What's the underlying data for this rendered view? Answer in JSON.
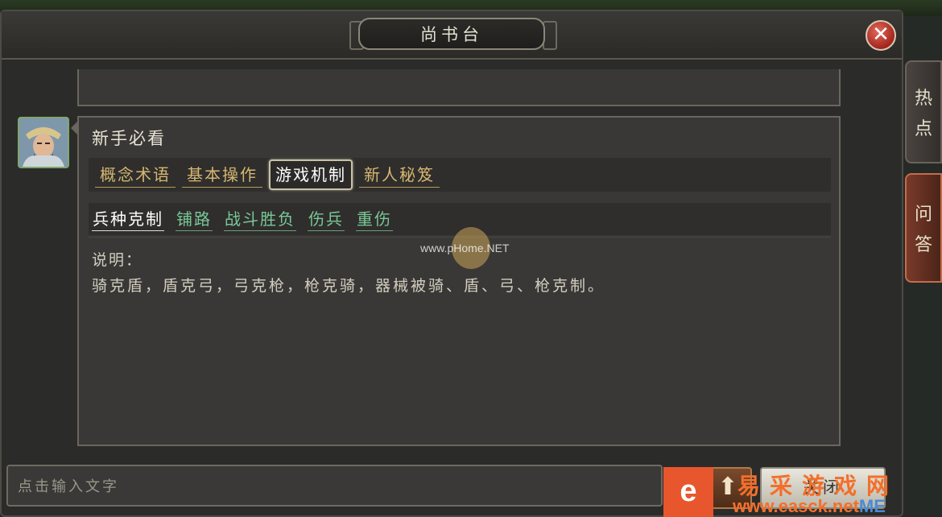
{
  "window": {
    "title": "尚书台",
    "close_symbol": "✕"
  },
  "guide": {
    "heading": "新手必看",
    "tabs": [
      {
        "label": "概念术语",
        "active": false
      },
      {
        "label": "基本操作",
        "active": false
      },
      {
        "label": "游戏机制",
        "active": true
      },
      {
        "label": "新人秘笈",
        "active": false
      }
    ],
    "subtabs": [
      {
        "label": "兵种克制",
        "active": true
      },
      {
        "label": "铺路",
        "active": false
      },
      {
        "label": "战斗胜负",
        "active": false
      },
      {
        "label": "伤兵",
        "active": false
      },
      {
        "label": "重伤",
        "active": false
      }
    ],
    "description_label": "说明：",
    "description": "骑克盾，盾克弓，弓克枪，枪克骑，器械被骑、盾、弓、枪克制。"
  },
  "side_tabs": {
    "hot": [
      "热",
      "点"
    ],
    "qa": [
      "问",
      "答"
    ]
  },
  "chat": {
    "input_placeholder": "点击输入文字",
    "up_symbol": "⬆",
    "send_label": "关闭"
  },
  "watermark": {
    "text": "www.pHome.NET"
  },
  "brand": {
    "logo": "e",
    "name": "易采游戏网",
    "url": "www.easck.net",
    "url_suffix": "ME"
  },
  "colors": {
    "tab_text": "#d6b772",
    "subtab_text": "#79c898",
    "close_red": "#a3251c",
    "brand_orange": "#f36f2a"
  }
}
